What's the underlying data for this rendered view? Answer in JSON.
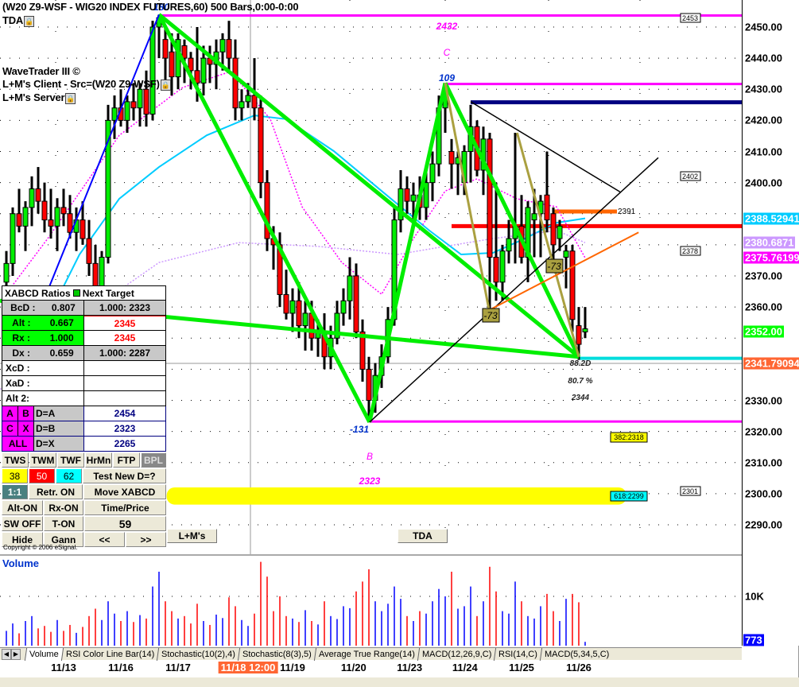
{
  "header": {
    "title": "(W20 Z9-WSF - WIG20 INDEX FUTURES,60) 500 Bars,0:00-0:00",
    "tda": "TDA",
    "wavetrader": "WaveTrader III ©",
    "client": "L+M's Client - Src=(W20 Z9-WSF)",
    "server": "L+M's Server"
  },
  "axis": {
    "ticks": [
      "2450.00",
      "2440.00",
      "2430.00",
      "2420.00",
      "2410.00",
      "2400.00",
      "2370.00",
      "2360.00",
      "2330.00",
      "2320.00",
      "2310.00",
      "2300.00",
      "2290.00"
    ],
    "tick_values": [
      2450,
      2440,
      2430,
      2420,
      2410,
      2400,
      2370,
      2360,
      2330,
      2320,
      2310,
      2300,
      2290
    ],
    "badges": [
      {
        "text": "2388.52941",
        "price": 2388.53,
        "bg": "#00ccff",
        "fg": "#fff"
      },
      {
        "text": "2380.6871",
        "price": 2380.69,
        "bg": "#cc99ff",
        "fg": "#fff"
      },
      {
        "text": "2375.76199",
        "price": 2375.76,
        "bg": "#ff00ff",
        "fg": "#fff"
      },
      {
        "text": "2352.00",
        "price": 2352.0,
        "bg": "#00ff00",
        "fg": "#fff"
      },
      {
        "text": "2341.79094",
        "price": 2341.79,
        "bg": "#ff6633",
        "fg": "#fff"
      }
    ],
    "vol_tick": "10K",
    "vol_badge": "773"
  },
  "annotations": {
    "c_price": "2432",
    "c_label": "C",
    "c_count": "109",
    "b_count": "-131",
    "b_label": "B",
    "b_price": "2323",
    "x_top": "180",
    "box1": "-73",
    "box2": "-73",
    "d_ratio": "88.2D",
    "d_pct": "80.7 %",
    "d_price": "2344",
    "orange_lvl": "2391",
    "lvl_2453": "2453",
    "lvl_2402": "2402",
    "lvl_2378": "2378",
    "lvl_2301": "2301",
    "fib382": "382:2318",
    "fib618": "618:2299"
  },
  "table": {
    "title_left": "XABCD Ratios",
    "title_right": "Next Target",
    "rows": [
      {
        "l": "BcD :",
        "v": "0.807",
        "t": "1.000: 2323"
      },
      {
        "l": "Alt  :",
        "v": "0.667",
        "t": "2345"
      },
      {
        "l": "Rx  :",
        "v": "1.000",
        "t": "2345"
      },
      {
        "l": "Dx  :",
        "v": "0.659",
        "t": "1.000: 2287"
      }
    ],
    "xcd": "XcD :",
    "xad": "XaD :",
    "alt2": "Alt 2:",
    "a": "A",
    "b": "B",
    "c": "C",
    "x": "X",
    "all": "ALL",
    "da": "D=A",
    "db": "D=B",
    "dx": "D=X",
    "da_v": "2454",
    "db_v": "2323",
    "dx_v": "2265"
  },
  "buttons": {
    "tws": "TWS",
    "twm": "TWM",
    "twf": "TWF",
    "hrmn": "HrMn",
    "ftp": "FTP",
    "bpl": "BPL",
    "n38": "38",
    "n50": "50",
    "n62": "62",
    "test": "Test New D=?",
    "ratio": "1:1",
    "retr": "Retr. ON",
    "move": "Move XABCD",
    "alt": "Alt-ON",
    "rx": "Rx-ON",
    "timeprice": "Time/Price",
    "sw": "SW OFF",
    "ton": "T-ON",
    "num": "59",
    "hide": "Hide",
    "gann": "Gann",
    "prev": "<<",
    "next": ">>",
    "lm": "L+M's",
    "tda": "TDA"
  },
  "copyright": "Copyright © 2006 eSignal.",
  "volume_label": "Volume",
  "tabs": [
    "Volume",
    "RSI Color Line Bar(14)",
    "Stochastic(10(2),4)",
    "Stochastic(8(3),5)",
    "Average True Range(14)",
    "MACD(12,26,9,C)",
    "RSI(14,C)",
    "MACD(5,34,5,C)"
  ],
  "dates": [
    {
      "t": "11/13",
      "bar": 9
    },
    {
      "t": "11/16",
      "bar": 18
    },
    {
      "t": "11/17",
      "bar": 27
    },
    {
      "t": "11/18 12:00",
      "bar": 38,
      "hl": true
    },
    {
      "t": "11/19",
      "bar": 45
    },
    {
      "t": "11/20",
      "bar": 54.6
    },
    {
      "t": "11/23",
      "bar": 63.4
    },
    {
      "t": "11/24",
      "bar": 72.1
    },
    {
      "t": "11/25",
      "bar": 81
    },
    {
      "t": "11/26",
      "bar": 90
    }
  ],
  "chart_data": {
    "type": "candlestick",
    "ylim": [
      2282,
      2458
    ],
    "up_color": "#00ee00",
    "down_color": "#ff0000",
    "ohlc": [
      [
        2368,
        2378,
        2362,
        2374
      ],
      [
        2374,
        2392,
        2370,
        2390
      ],
      [
        2390,
        2398,
        2384,
        2386
      ],
      [
        2386,
        2394,
        2378,
        2392
      ],
      [
        2392,
        2402,
        2386,
        2398
      ],
      [
        2398,
        2405,
        2390,
        2394
      ],
      [
        2394,
        2400,
        2384,
        2388
      ],
      [
        2388,
        2398,
        2382,
        2386
      ],
      [
        2386,
        2395,
        2378,
        2392
      ],
      [
        2392,
        2398,
        2386,
        2390
      ],
      [
        2390,
        2396,
        2382,
        2384
      ],
      [
        2384,
        2392,
        2378,
        2388
      ],
      [
        2388,
        2394,
        2380,
        2382
      ],
      [
        2382,
        2388,
        2370,
        2374
      ],
      [
        2374,
        2380,
        2362,
        2366
      ],
      [
        2366,
        2378,
        2362,
        2376
      ],
      [
        2376,
        2425,
        2374,
        2420
      ],
      [
        2420,
        2428,
        2414,
        2424
      ],
      [
        2424,
        2430,
        2418,
        2420
      ],
      [
        2420,
        2428,
        2416,
        2426
      ],
      [
        2426,
        2432,
        2420,
        2424
      ],
      [
        2424,
        2432,
        2418,
        2430
      ],
      [
        2430,
        2436,
        2418,
        2422
      ],
      [
        2422,
        2452,
        2420,
        2450
      ],
      [
        2450,
        2454,
        2440,
        2453
      ],
      [
        2446,
        2450,
        2430,
        2440
      ],
      [
        2442,
        2448,
        2428,
        2434
      ],
      [
        2434,
        2448,
        2430,
        2446
      ],
      [
        2444,
        2446,
        2432,
        2440
      ],
      [
        2440,
        2442,
        2430,
        2436
      ],
      [
        2436,
        2450,
        2426,
        2432
      ],
      [
        2432,
        2444,
        2428,
        2440
      ],
      [
        2440,
        2444,
        2432,
        2438
      ],
      [
        2438,
        2446,
        2430,
        2442
      ],
      [
        2442,
        2448,
        2436,
        2446
      ],
      [
        2446,
        2452,
        2436,
        2440
      ],
      [
        2440,
        2446,
        2420,
        2424
      ],
      [
        2424,
        2430,
        2420,
        2426
      ],
      [
        2426,
        2432,
        2424,
        2428
      ],
      [
        2428,
        2440,
        2420,
        2424
      ],
      [
        2424,
        2428,
        2395,
        2400
      ],
      [
        2400,
        2404,
        2378,
        2382
      ],
      [
        2382,
        2386,
        2372,
        2380
      ],
      [
        2380,
        2384,
        2360,
        2364
      ],
      [
        2364,
        2372,
        2356,
        2358
      ],
      [
        2358,
        2366,
        2352,
        2362
      ],
      [
        2362,
        2368,
        2350,
        2354
      ],
      [
        2354,
        2362,
        2346,
        2358
      ],
      [
        2358,
        2362,
        2346,
        2350
      ],
      [
        2350,
        2356,
        2344,
        2352
      ],
      [
        2352,
        2358,
        2340,
        2344
      ],
      [
        2344,
        2354,
        2340,
        2350
      ],
      [
        2350,
        2362,
        2348,
        2358
      ],
      [
        2358,
        2366,
        2354,
        2362
      ],
      [
        2362,
        2376,
        2356,
        2370
      ],
      [
        2370,
        2374,
        2350,
        2352
      ],
      [
        2352,
        2356,
        2336,
        2340
      ],
      [
        2340,
        2344,
        2323,
        2330
      ],
      [
        2330,
        2342,
        2326,
        2338
      ],
      [
        2338,
        2348,
        2334,
        2344
      ],
      [
        2344,
        2360,
        2342,
        2356
      ],
      [
        2356,
        2392,
        2354,
        2388
      ],
      [
        2388,
        2404,
        2384,
        2398
      ],
      [
        2398,
        2402,
        2390,
        2394
      ],
      [
        2394,
        2400,
        2388,
        2396
      ],
      [
        2396,
        2402,
        2388,
        2392
      ],
      [
        2392,
        2404,
        2388,
        2400
      ],
      [
        2400,
        2410,
        2394,
        2406
      ],
      [
        2406,
        2428,
        2402,
        2424
      ],
      [
        2424,
        2432,
        2416,
        2430
      ],
      [
        2410,
        2414,
        2398,
        2406
      ],
      [
        2406,
        2410,
        2396,
        2408
      ],
      [
        2400,
        2412,
        2396,
        2410
      ],
      [
        2410,
        2425,
        2400,
        2418
      ],
      [
        2418,
        2420,
        2402,
        2404
      ],
      [
        2404,
        2418,
        2396,
        2414
      ],
      [
        2414,
        2416,
        2358,
        2376
      ],
      [
        2376,
        2400,
        2362,
        2368
      ],
      [
        2368,
        2380,
        2362,
        2378
      ],
      [
        2378,
        2388,
        2374,
        2382
      ],
      [
        2382,
        2416,
        2374,
        2386
      ],
      [
        2386,
        2396,
        2374,
        2376
      ],
      [
        2376,
        2394,
        2368,
        2392
      ],
      [
        2388,
        2398,
        2376,
        2390
      ],
      [
        2390,
        2396,
        2376,
        2394
      ],
      [
        2396,
        2410,
        2384,
        2388
      ],
      [
        2390,
        2392,
        2374,
        2380
      ],
      [
        2382,
        2388,
        2378,
        2386
      ],
      [
        2376,
        2380,
        2366,
        2378
      ],
      [
        2378,
        2380,
        2352,
        2356
      ],
      [
        2354,
        2360,
        2343,
        2348
      ],
      [
        2352,
        2360,
        2350,
        2353
      ]
    ],
    "volume": [
      3000,
      4500,
      2500,
      5000,
      6000,
      3500,
      4000,
      2800,
      5200,
      3000,
      4200,
      2600,
      3800,
      6000,
      7500,
      5200,
      9000,
      6500,
      5000,
      7000,
      4800,
      6200,
      5500,
      12000,
      15000,
      9000,
      7000,
      5500,
      6000,
      4500,
      8500,
      5000,
      4200,
      6300,
      5600,
      9800,
      8000,
      5200,
      4000,
      6500,
      17000,
      14000,
      7000,
      10000,
      6000,
      5500,
      4800,
      7200,
      5000,
      4300,
      9000,
      6000,
      5400,
      8000,
      7600,
      11000,
      13000,
      15500,
      9000,
      7000,
      8500,
      12000,
      9500,
      6000,
      5000,
      7000,
      6500,
      9000,
      11500,
      10000,
      15000,
      7500,
      8000,
      12000,
      6000,
      9000,
      16000,
      11000,
      7000,
      6500,
      13000,
      9000,
      6000,
      5500,
      8000,
      10500,
      7000,
      5000,
      9500,
      10500,
      8800,
      773
    ],
    "moving_averages": [
      {
        "color": "#00ccff",
        "style": "solid",
        "points": [
          [
            4,
            2346.2
          ],
          [
            11.5,
            2376.9
          ],
          [
            17.75,
            2394.8
          ],
          [
            24,
            2405
          ],
          [
            31.5,
            2415.2
          ],
          [
            39,
            2421.6
          ],
          [
            44,
            2420.4
          ],
          [
            51.5,
            2410.1
          ],
          [
            59,
            2397.3
          ],
          [
            66.5,
            2384.6
          ],
          [
            71.5,
            2376.9
          ],
          [
            76.5,
            2377.4
          ],
          [
            81.5,
            2382
          ],
          [
            86.5,
            2387.1
          ],
          [
            91,
            2388.5
          ]
        ]
      },
      {
        "color": "#ff00ff",
        "style": "dotted",
        "points": [
          [
            -1,
            2361.6
          ],
          [
            6.5,
            2382
          ],
          [
            17.75,
            2415.2
          ],
          [
            27.75,
            2430.6
          ],
          [
            35.25,
            2435.7
          ],
          [
            41.5,
            2420.4
          ],
          [
            46.5,
            2392.2
          ],
          [
            52.75,
            2374.3
          ],
          [
            59,
            2364.1
          ],
          [
            64,
            2382
          ],
          [
            69,
            2397.3
          ],
          [
            74,
            2401.2
          ],
          [
            80.25,
            2394.8
          ],
          [
            86.5,
            2392.2
          ],
          [
            91,
            2375.8
          ]
        ]
      },
      {
        "color": "#cc99ff",
        "style": "dotted",
        "points": [
          [
            -1,
            2333.5
          ],
          [
            11.5,
            2356.5
          ],
          [
            24,
            2374.3
          ],
          [
            36.5,
            2380.7
          ],
          [
            49,
            2379.5
          ],
          [
            61.5,
            2376.9
          ],
          [
            69,
            2379.5
          ],
          [
            76.5,
            2382
          ],
          [
            86.5,
            2384.6
          ],
          [
            91,
            2380.7
          ]
        ]
      }
    ],
    "pattern_lines": [
      {
        "color": "#00ee00",
        "w": 5,
        "from": [
          24,
          2454
        ],
        "to": [
          57.1,
          2323
        ]
      },
      {
        "color": "#00ee00",
        "w": 5,
        "from": [
          24,
          2454
        ],
        "to": [
          90,
          2344
        ]
      },
      {
        "color": "#00ee00",
        "w": 5,
        "from": [
          57.1,
          2323
        ],
        "to": [
          69,
          2432
        ]
      },
      {
        "color": "#00ee00",
        "w": 5,
        "from": [
          69,
          2432
        ],
        "to": [
          90,
          2344
        ]
      },
      {
        "color": "#00ee00",
        "w": 5,
        "from": [
          -1,
          2362
        ],
        "to": [
          90,
          2344
        ]
      },
      {
        "color": "#0000ff",
        "w": 2,
        "from": [
          2.7,
          2346
        ],
        "to": [
          24,
          2454
        ]
      },
      {
        "color": "#000000",
        "w": 1.5,
        "from": [
          57.1,
          2323
        ],
        "to": [
          102.5,
          2408
        ]
      },
      {
        "color": "#000000",
        "w": 1.5,
        "from": [
          73,
          2426
        ],
        "to": [
          96.5,
          2397
        ]
      },
      {
        "color": "#aaa040",
        "w": 3,
        "from": [
          69,
          2432
        ],
        "to": [
          75.9,
          2359
        ]
      },
      {
        "color": "#aaa040",
        "w": 3,
        "from": [
          80.3,
          2416
        ],
        "to": [
          90,
          2344
        ]
      },
      {
        "color": "#ff6600",
        "w": 2,
        "from": [
          75.9,
          2359
        ],
        "to": [
          99.4,
          2384
        ]
      }
    ],
    "levels": [
      {
        "price": 2453.7,
        "from": 24,
        "color": "#ff00ff",
        "w": 3
      },
      {
        "price": 2431.7,
        "from": 69,
        "color": "#ff00ff",
        "w": 3
      },
      {
        "price": 2425.8,
        "from": 73,
        "color": "#000080",
        "w": 5
      },
      {
        "price": 2386,
        "from": 70,
        "color": "#ff0000",
        "w": 5
      },
      {
        "price": 2390.7,
        "from": 86,
        "to": 96,
        "color": "#ff6600",
        "w": 5
      },
      {
        "price": 2343.5,
        "from": 90,
        "color": "#00dddd",
        "w": 4
      },
      {
        "price": 2323.2,
        "from": 57.1,
        "color": "#ff00ff",
        "w": 3
      }
    ],
    "yellow_zone": {
      "from": 25.2,
      "to": 97.5,
      "price_hi": 2302,
      "price_lo": 2296.5
    }
  }
}
